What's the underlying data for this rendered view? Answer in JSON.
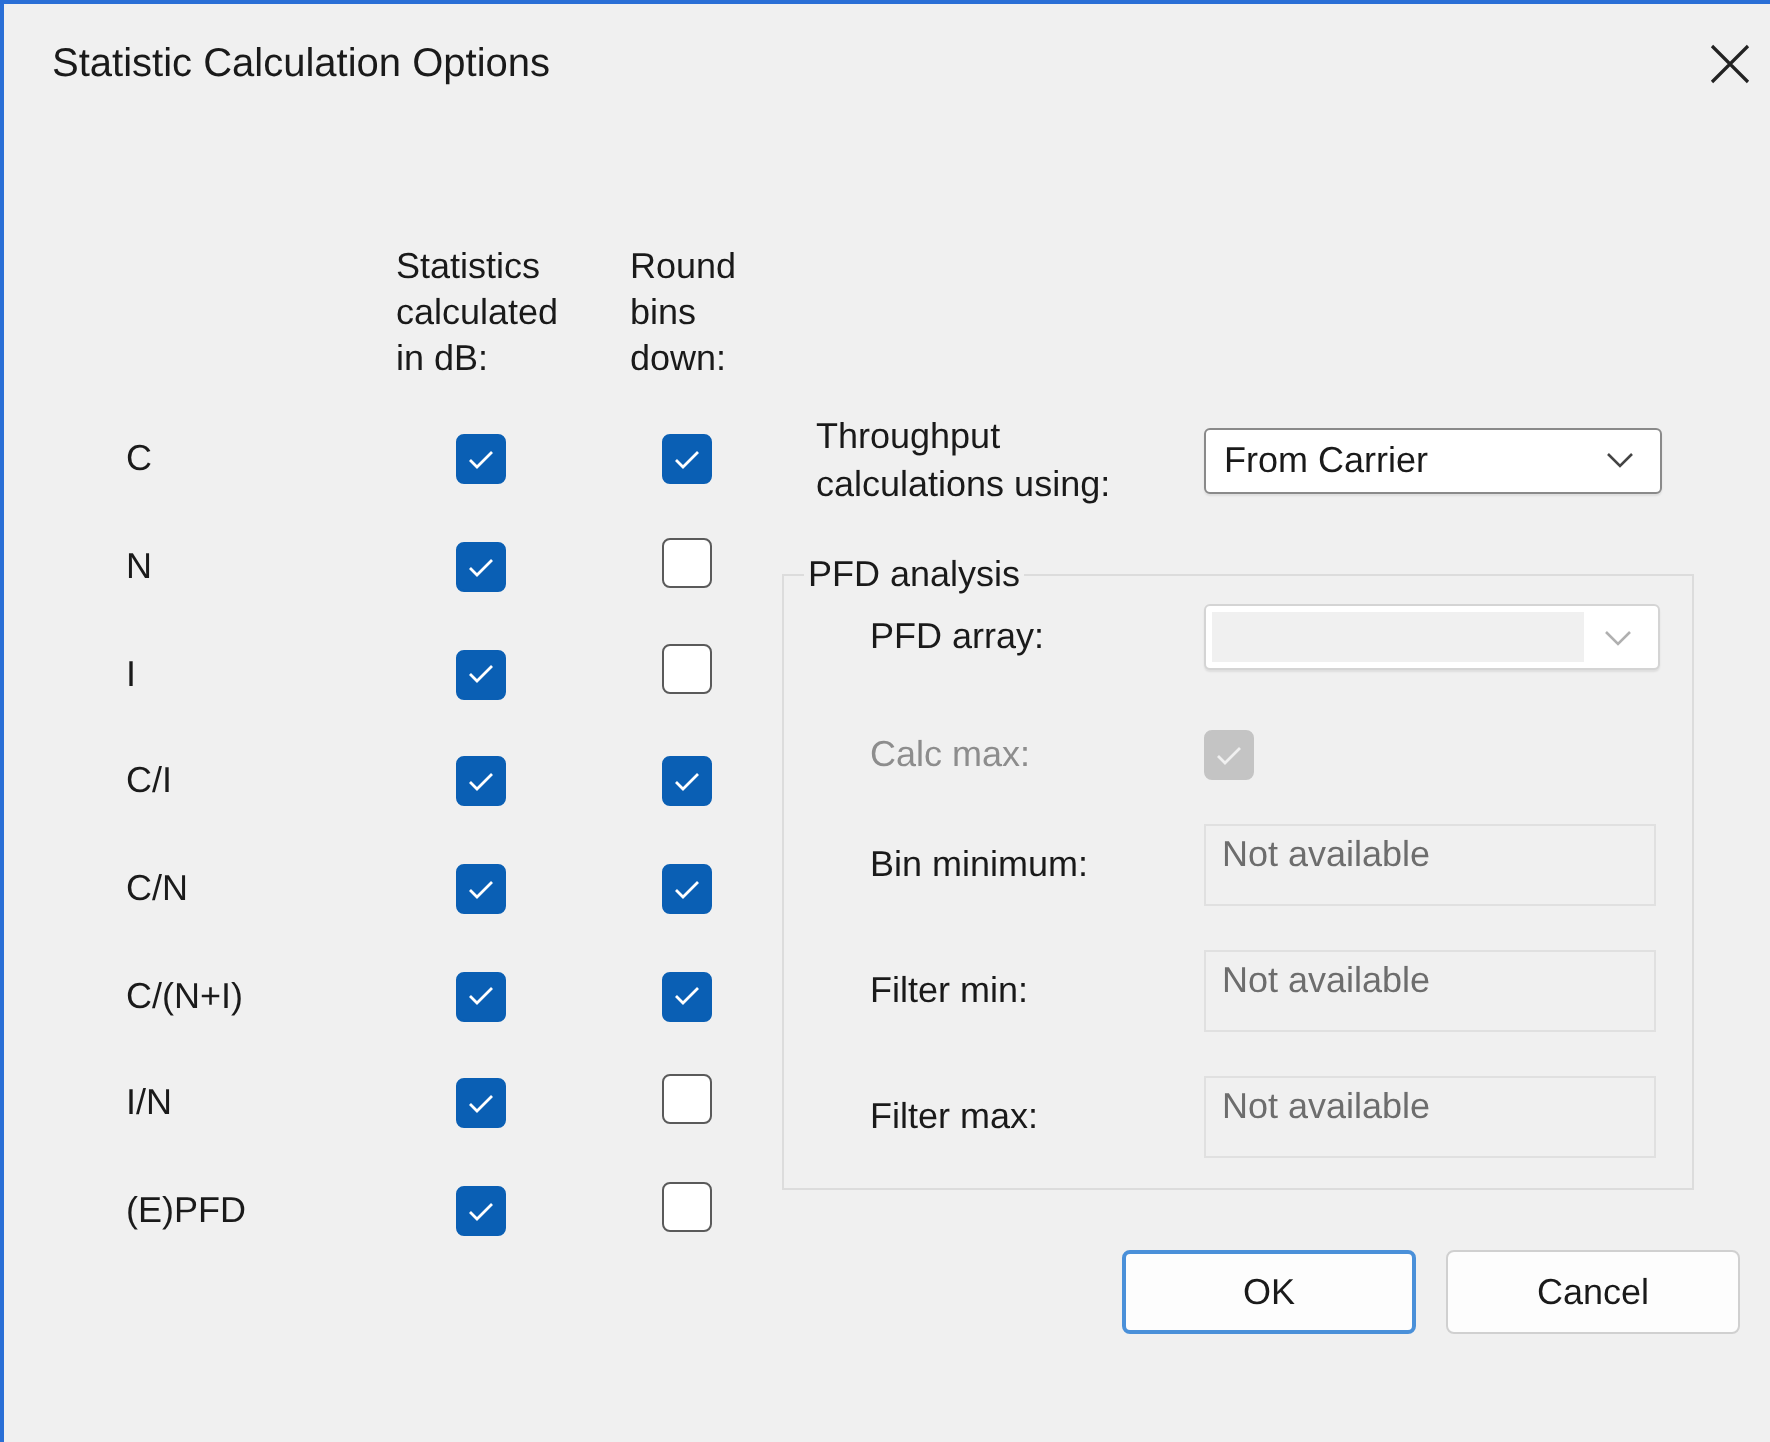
{
  "window": {
    "title": "Statistic Calculation Options"
  },
  "columns": [
    "Statistics calculated in dB:",
    "Round bins down:"
  ],
  "rows": [
    {
      "label": "C",
      "in_db": true,
      "round_down": true
    },
    {
      "label": "N",
      "in_db": true,
      "round_down": false
    },
    {
      "label": "I",
      "in_db": true,
      "round_down": false
    },
    {
      "label": "C/I",
      "in_db": true,
      "round_down": true
    },
    {
      "label": "C/N",
      "in_db": true,
      "round_down": true
    },
    {
      "label": "C/(N+I)",
      "in_db": true,
      "round_down": true
    },
    {
      "label": "I/N",
      "in_db": true,
      "round_down": false
    },
    {
      "label": "(E)PFD",
      "in_db": true,
      "round_down": false
    }
  ],
  "throughput": {
    "label": "Throughput calculations using:",
    "value": "From Carrier",
    "disabled": false
  },
  "pfd": {
    "title": "PFD analysis",
    "array": {
      "label": "PFD array:",
      "disabled": true
    },
    "calc_max": {
      "label": "Calc max:",
      "checked": true,
      "disabled": true
    },
    "fields": [
      {
        "label": "Bin minimum:",
        "value": "Not available",
        "disabled": true
      },
      {
        "label": "Filter min:",
        "value": "Not available",
        "disabled": true
      },
      {
        "label": "Filter max:",
        "value": "Not available",
        "disabled": true
      }
    ]
  },
  "buttons": [
    {
      "label": "OK",
      "default": true
    },
    {
      "label": "Cancel",
      "default": false
    }
  ]
}
